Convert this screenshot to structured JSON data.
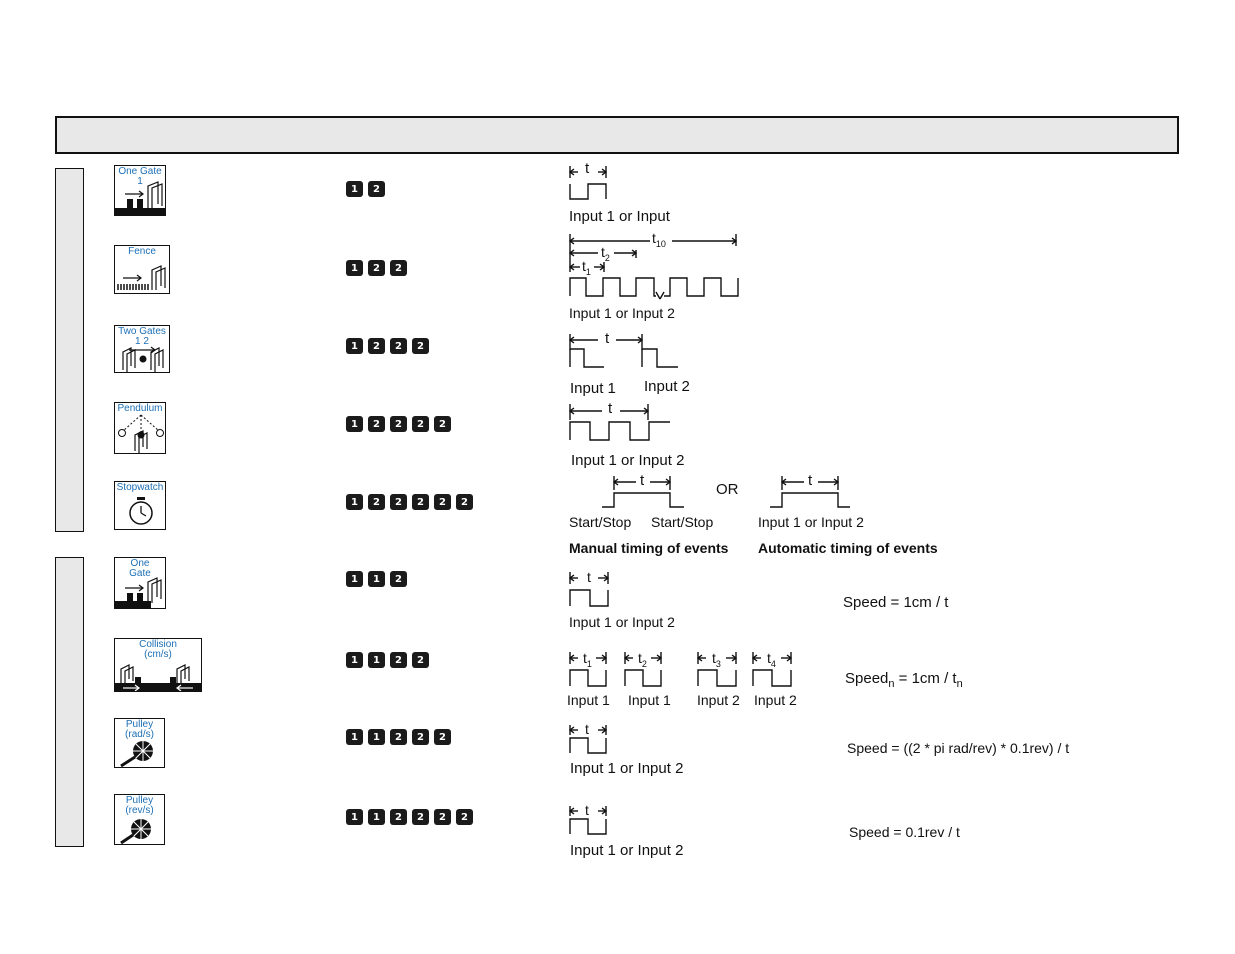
{
  "rows": [
    {
      "icon": "One Gate\n1",
      "keys": [
        "1",
        "2"
      ]
    },
    {
      "icon": "Fence",
      "keys": [
        "1",
        "2",
        "2"
      ]
    },
    {
      "icon": "Two Gates\n1       2",
      "keys": [
        "1",
        "2",
        "2",
        "2"
      ]
    },
    {
      "icon": "Pendulum",
      "keys": [
        "1",
        "2",
        "2",
        "2",
        "2"
      ]
    },
    {
      "icon": "Stopwatch",
      "keys": [
        "1",
        "2",
        "2",
        "2",
        "2",
        "2"
      ]
    },
    {
      "icon": "One\nGate",
      "keys": [
        "1",
        "1",
        "2"
      ]
    },
    {
      "icon": "Collision\n(cm/s)",
      "keys": [
        "1",
        "1",
        "2",
        "2"
      ]
    },
    {
      "icon": "Pulley\n(rad/s)",
      "keys": [
        "1",
        "1",
        "2",
        "2",
        "2"
      ]
    },
    {
      "icon": "Pulley\n(rev/s)",
      "keys": [
        "1",
        "1",
        "2",
        "2",
        "2",
        "2"
      ]
    }
  ],
  "labels": {
    "t": "t",
    "t10": "t",
    "t10sub": "10",
    "t2": "t",
    "t2sub": "2",
    "t1": "t",
    "t1sub": "1",
    "t3sub": "3",
    "t4sub": "4",
    "r1": "Input 1  or  Input",
    "r2": "Input 1  or  Input 2",
    "r3a": "Input 1",
    "r3b": "Input 2",
    "r4": "Input 1 or  Input 2",
    "r5or": "OR",
    "r5a": "Start/Stop",
    "r5b": "Start/Stop",
    "r5c": "Input 1 or Input 2",
    "r5manual": "Manual timing of events",
    "r5auto": "Automatic timing of events",
    "r6": "Input 1 or Input 2",
    "r7a": "Input 1",
    "r7b": "Input 1",
    "r7c": "Input 2",
    "r7d": "Input 2",
    "r8": "Input 1 or  Input 2",
    "r9": "Input 1 or  Input 2"
  },
  "formulas": {
    "f6": "Speed = 1cm / t",
    "f7a": "Speed",
    "f7b": "n",
    "f7c": " = 1cm / t",
    "f7d": "n",
    "f8": "Speed = ((2 * pi rad/rev) * 0.1rev) / t",
    "f9": "Speed = 0.1rev / t"
  }
}
